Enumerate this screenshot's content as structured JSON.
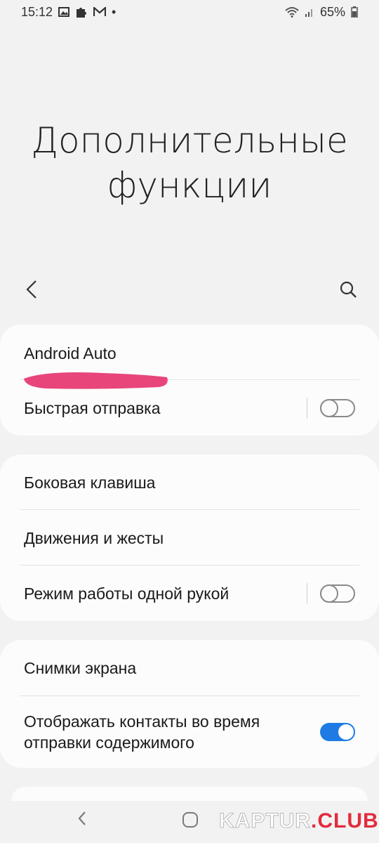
{
  "status_bar": {
    "time": "15:12",
    "dot": "•",
    "battery": "65%"
  },
  "header": {
    "title_line1": "Дополнительные",
    "title_line2": "функции"
  },
  "groups": [
    {
      "items": [
        {
          "label": "Android Auto"
        },
        {
          "label": "Быстрая отправка",
          "toggle": "off"
        }
      ]
    },
    {
      "items": [
        {
          "label": "Боковая клавиша"
        },
        {
          "label": "Движения и жесты"
        },
        {
          "label": "Режим работы одной рукой",
          "toggle": "off"
        }
      ]
    },
    {
      "items": [
        {
          "label": "Снимки экрана"
        },
        {
          "label_line1": "Отображать контакты во время",
          "label_line2": "отправки содержимого",
          "toggle": "on"
        }
      ]
    }
  ],
  "watermark": {
    "part1": "KAPTUR",
    "part2": ".CLUB"
  },
  "colors": {
    "background": "#f2f2f2",
    "card": "#fcfcfc",
    "toggle_on": "#1f7be3",
    "highlight": "#e8457a",
    "watermark_accent": "#e22b3e"
  }
}
